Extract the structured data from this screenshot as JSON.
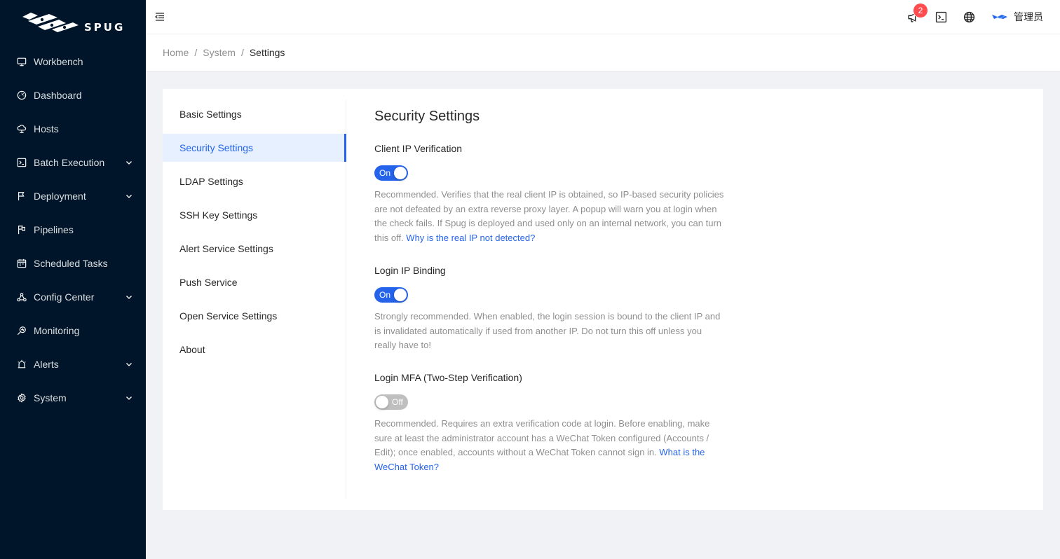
{
  "app": {
    "logo_text": "SPUG"
  },
  "sidebar": {
    "items": [
      {
        "label": "Workbench",
        "icon": "desktop-icon",
        "has_submenu": false
      },
      {
        "label": "Dashboard",
        "icon": "dashboard-icon",
        "has_submenu": false
      },
      {
        "label": "Hosts",
        "icon": "cloud-server-icon",
        "has_submenu": false
      },
      {
        "label": "Batch Execution",
        "icon": "code-icon",
        "has_submenu": true
      },
      {
        "label": "Deployment",
        "icon": "flag-icon",
        "has_submenu": true
      },
      {
        "label": "Pipelines",
        "icon": "pipeline-icon",
        "has_submenu": false
      },
      {
        "label": "Scheduled Tasks",
        "icon": "schedule-icon",
        "has_submenu": false
      },
      {
        "label": "Config Center",
        "icon": "deployment-unit-icon",
        "has_submenu": true
      },
      {
        "label": "Monitoring",
        "icon": "monitor-icon",
        "has_submenu": false
      },
      {
        "label": "Alerts",
        "icon": "alert-icon",
        "has_submenu": true
      },
      {
        "label": "System",
        "icon": "setting-icon",
        "has_submenu": true
      }
    ]
  },
  "header": {
    "notification_count": "2",
    "user_name": "管理员"
  },
  "breadcrumb": [
    "Home",
    "System",
    "Settings"
  ],
  "settings_menu": {
    "items": [
      "Basic Settings",
      "Security Settings",
      "LDAP Settings",
      "SSH Key Settings",
      "Alert Service Settings",
      "Push Service",
      "Open Service Settings",
      "About"
    ],
    "active": "Security Settings"
  },
  "security": {
    "title": "Security Settings",
    "client_ip": {
      "label": "Client IP Verification",
      "state": "On",
      "desc": "Recommended. Verifies that the real client IP is obtained, so IP-based security policies are not defeated by an extra reverse proxy layer. A popup will warn you at login when the check fails. If Spug is deployed and used only on an internal network, you can turn this off. ",
      "link": "Why is the real IP not detected?"
    },
    "ip_binding": {
      "label": "Login IP Binding",
      "state": "On",
      "desc": "Strongly recommended. When enabled, the login session is bound to the client IP and is invalidated automatically if used from another IP. Do not turn this off unless you really have to!"
    },
    "mfa": {
      "label": "Login MFA (Two-Step Verification)",
      "state": "Off",
      "desc": "Recommended. Requires an extra verification code at login. Before enabling, make sure at least the administrator account has a WeChat Token configured (Accounts / Edit); once enabled, accounts without a WeChat Token cannot sign in. ",
      "link": "What is the WeChat Token?"
    }
  },
  "colors": {
    "sidebar_bg": "#001529",
    "primary": "#2563eb",
    "badge": "#ff4d4f"
  }
}
